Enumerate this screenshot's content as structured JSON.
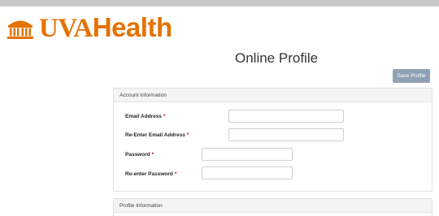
{
  "header": {
    "logo_text_uva": "UVA",
    "logo_text_health": "Health",
    "brand_color": "#e57200",
    "logo_icon": "rotunda-icon"
  },
  "page": {
    "title": "Online Profile"
  },
  "toolbar": {
    "save_label": "Save Profile"
  },
  "account_section": {
    "title": "Account Information",
    "fields": [
      {
        "label": "Email Address",
        "required_mark": "*",
        "value": ""
      },
      {
        "label": "Re-Enter Email Address",
        "required_mark": "*",
        "value": ""
      },
      {
        "label": "Password",
        "required_mark": "*",
        "value": ""
      },
      {
        "label": "Re-enter Password",
        "required_mark": "*",
        "value": ""
      }
    ]
  },
  "profile_section": {
    "title": "Profile Information"
  },
  "colors": {
    "required": "#cc0000",
    "save_button": "#8fa2b5"
  }
}
